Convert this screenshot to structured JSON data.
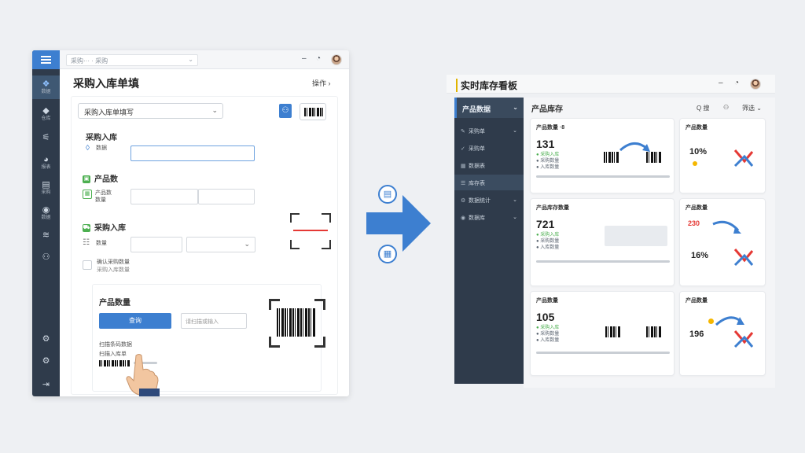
{
  "left_window": {
    "breadcrumb": "采购··· · 采购",
    "title": "采购入库单填",
    "actions_label": "操作",
    "rail": [
      {
        "icon": "dashboard-icon",
        "label": "数据"
      },
      {
        "icon": "box-icon",
        "label": "仓库"
      },
      {
        "icon": "chart-icon",
        "label": ""
      },
      {
        "icon": "pie-icon",
        "label": "报表"
      },
      {
        "icon": "report-icon",
        "label": "采购"
      },
      {
        "icon": "globe-icon",
        "label": "数据"
      },
      {
        "icon": "layers-icon",
        "label": ""
      },
      {
        "icon": "user-icon",
        "label": ""
      }
    ],
    "form": {
      "order_select": "采购入库单填写",
      "section1": {
        "title": "采购入库",
        "label": "数据"
      },
      "section2": {
        "title": "产品数",
        "label": "产品数\n数量"
      },
      "section3": {
        "title": "采购入库",
        "label": "数量"
      },
      "checkbox_label": "确认采购数量",
      "checkbox_sub": "采购入库数量",
      "panel": {
        "title": "产品数量",
        "query_button": "查询",
        "query_placeholder": "请扫描或输入",
        "list": [
          "扫描条码数据",
          "扫描入库单"
        ]
      }
    }
  },
  "right_window": {
    "title": "实时库存看板",
    "sidebar_header": "产品数据",
    "sidebar": [
      {
        "icon": "wrench-icon",
        "label": "采购单"
      },
      {
        "icon": "check-icon",
        "label": "采购单"
      },
      {
        "icon": "grid-icon",
        "label": "数据表"
      },
      {
        "icon": "list-icon",
        "label": "库存表"
      },
      {
        "icon": "gear-icon",
        "label": "数据统计"
      },
      {
        "icon": "globe-icon",
        "label": "数据库"
      }
    ],
    "main_title": "产品库存",
    "tools": {
      "search": "Q 搜",
      "user": "⚇",
      "filter": "筛选"
    },
    "cards_left": [
      {
        "title": "产品数量 ·8",
        "value": "131",
        "lines": [
          "● 采购入库",
          "● 采购数量",
          "● 入库数量"
        ]
      },
      {
        "title": "产品库存数量",
        "value": "721",
        "lines": [
          "● 采购入库",
          "● 采购数量",
          "● 入库数量"
        ]
      },
      {
        "title": "产品数量",
        "value": "105",
        "lines": [
          "● 采购入库",
          "● 采购数量",
          "● 入库数量"
        ]
      }
    ],
    "cards_right": [
      {
        "title": "产品数量",
        "value": "10%",
        "extra": ""
      },
      {
        "title": "产品数量",
        "value": "16%",
        "extra": "230"
      },
      {
        "title": "产品数量",
        "value": "196",
        "extra": ""
      }
    ]
  },
  "colors": {
    "accent": "#3d7fd0",
    "sidebar": "#2f3b4b",
    "success": "#4caf50",
    "warn": "#e53935"
  }
}
